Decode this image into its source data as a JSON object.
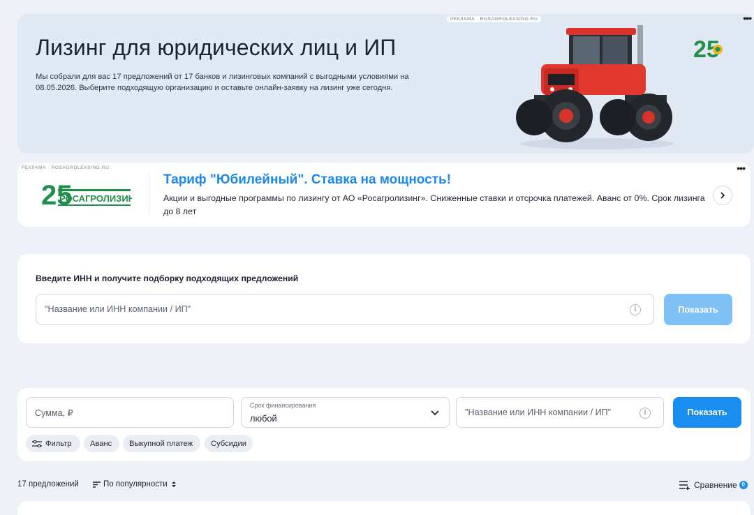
{
  "hero": {
    "ad_label": "РЕКЛАМА · ROSAGROLEASING.RU",
    "title": "Лизинг для юридических лиц и ИП",
    "description": "Мы собрали для вас 17 предложений от 17 банков и лизинговых компаний с выгодными условиями на 08.05.2026. Выберите подходящую организацию и оставьте онлайн-заявку на лизинг уже сегодня.",
    "logo_number": "25"
  },
  "ad_banner": {
    "ad_label": "РЕКЛАМА · ROSAGROLEASING.RU",
    "logo_number": "25",
    "logo_name": "РОСАГРОЛИЗИНГ",
    "title": "Тариф \"Юбилейный\". Ставка на мощность!",
    "text": "Акции и выгодные программы по лизингу от АО «Росагролизинг». Сниженные ставки и отсрочка платежей. Аванс от 0%. Срок лизинга до 8 лет"
  },
  "inn_search": {
    "label": "Введите ИНН и получите подборку подходящих предложений",
    "placeholder": "\"Название или ИНН компании / ИП\"",
    "button": "Показать"
  },
  "filter": {
    "amount_placeholder": "Сумма, ₽",
    "term_label": "Срок финансирования",
    "term_value": "любой",
    "company_placeholder": "\"Название или ИНН компании / ИП\"",
    "button": "Показать",
    "chips": [
      "Фильтр",
      "Аванс",
      "Выкупной платеж",
      "Субсидии"
    ]
  },
  "summary": {
    "count": "17 предложений",
    "sort": "По популярности",
    "compare": "Сравнение",
    "compare_count": "0"
  },
  "colors": {
    "accent": "#1a8df0",
    "accent_light": "#7fc0f5",
    "hero_bg": "#e1e9f4",
    "page_bg": "#eef2f8",
    "brand_green": "#1f8f4a"
  }
}
